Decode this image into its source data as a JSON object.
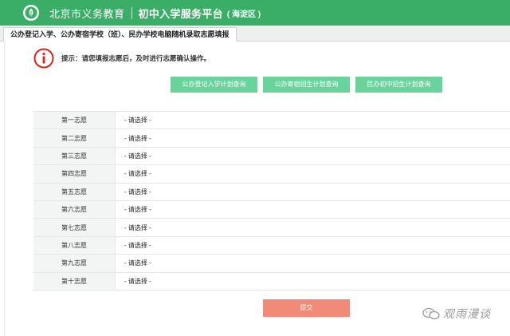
{
  "header": {
    "brand": "北京市义务教育",
    "platform": "初中入学服务平台",
    "district": "( 海淀区 )"
  },
  "tab": {
    "label": "公办登记入学、公办寄宿学校（班）、民办学校电脑随机录取志愿填报"
  },
  "tip": {
    "text": "提示：请您填报志愿后，及时进行志愿确认操作。"
  },
  "query_buttons": [
    {
      "label": "公办登记入学计划查询"
    },
    {
      "label": "公办寄宿招生计划查询"
    },
    {
      "label": "民办初中招生计划查询"
    }
  ],
  "choices": [
    {
      "label": "第一志愿",
      "value": "- 请选择 -"
    },
    {
      "label": "第二志愿",
      "value": "- 请选择 -"
    },
    {
      "label": "第三志愿",
      "value": "- 请选择 -"
    },
    {
      "label": "第四志愿",
      "value": "- 请选择 -"
    },
    {
      "label": "第五志愿",
      "value": "- 请选择 -"
    },
    {
      "label": "第六志愿",
      "value": "- 请选择 -"
    },
    {
      "label": "第七志愿",
      "value": "- 请选择 -"
    },
    {
      "label": "第八志愿",
      "value": "- 请选择 -"
    },
    {
      "label": "第九志愿",
      "value": "- 请选择 -"
    },
    {
      "label": "第十志愿",
      "value": "- 请选择 -"
    }
  ],
  "submit": {
    "label": "提交"
  },
  "watermark": {
    "text": "观雨漫谈"
  },
  "colors": {
    "header": "#3aae66",
    "query_button": "#68d49b",
    "submit_button": "#f18a76",
    "tip_icon": "#d9261c"
  },
  "icons": {
    "logo": "education-logo-icon",
    "tip": "info-icon",
    "dropdown": "chevron-down-icon",
    "watermark": "wechat-icon"
  }
}
